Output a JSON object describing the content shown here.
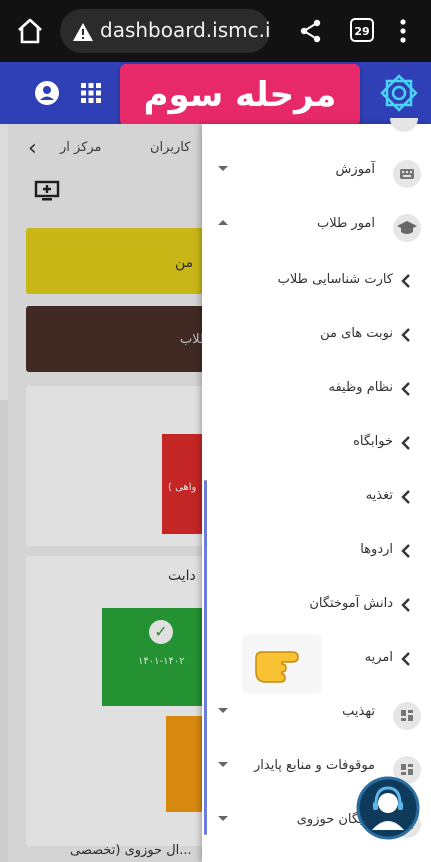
{
  "browser": {
    "url": "dashboard.ismc.ir",
    "tab_count": "29"
  },
  "appbar": {
    "banner": "مرحله سوم"
  },
  "background_page": {
    "tabs": [
      "کاربران",
      "مرکز ار"
    ],
    "yellow_card_text": "من",
    "brown_card_text": "طلاب",
    "red_card_text": "واهی )",
    "panel_title": "دایت",
    "green_card_text": "۱۴۰۱-۱۴۰۲",
    "bottom_text": "...ال حوزوی (تخصصی"
  },
  "drawer": {
    "menu": [
      {
        "label": "آموزش",
        "state": "collapsed",
        "icon": "keyboard-icon"
      },
      {
        "label": "امور طلاب",
        "state": "expanded",
        "icon": "graduation-cap-icon"
      },
      {
        "label": "تهذیب",
        "state": "collapsed",
        "icon": "dashboard-icon"
      },
      {
        "label": "موقوفات و منابع پایدار",
        "state": "collapsed",
        "icon": "dashboard-icon"
      },
      {
        "label": "نخبگان حوزوی",
        "state": "collapsed",
        "icon": "dashboard-icon"
      }
    ],
    "submenu": [
      "کارت شناسایی طلاب",
      "نوبت های من",
      "نظام وظیفه",
      "خوابگاه",
      "تغذیه",
      "اردوها",
      "دانش آموختگان",
      "امریه"
    ]
  },
  "colors": {
    "appbar": "#2f40b7",
    "banner": "#e7296a",
    "browserbar": "#121212"
  }
}
